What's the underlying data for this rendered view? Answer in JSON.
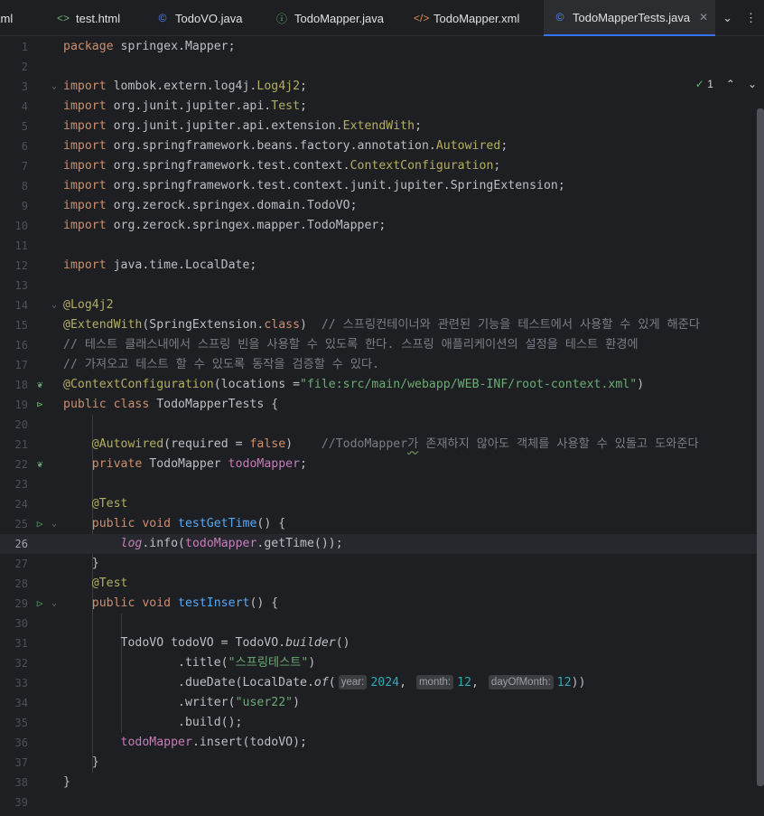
{
  "tabs": [
    {
      "label": "xml",
      "icon": "file-icon",
      "active": false
    },
    {
      "label": "test.html",
      "icon": "html-icon",
      "active": false
    },
    {
      "label": "TodoVO.java",
      "icon": "class-icon",
      "active": false
    },
    {
      "label": "TodoMapper.java",
      "icon": "interface-icon",
      "active": false
    },
    {
      "label": "TodoMapper.xml",
      "icon": "xml-icon",
      "active": false
    },
    {
      "label": "TodoMapperTests.java",
      "icon": "test-class-icon",
      "active": true
    }
  ],
  "tab_close_label": "✕",
  "tab_actions": {
    "chevron": "⌄",
    "more": "⋮"
  },
  "inspections": {
    "count": "1",
    "up": "⌃",
    "down": "⌄"
  },
  "current_line": 26,
  "colors": {
    "background": "#1e1f22",
    "keyword": "#cf8e6d",
    "annotation": "#b3ae60",
    "string": "#6aab73",
    "comment": "#7a7e85",
    "field": "#c77dbb",
    "method": "#56a8f5",
    "number": "#2aacb8",
    "accent": "#3574f0"
  },
  "lines": [
    {
      "n": "1",
      "t": [
        [
          "kw",
          "package "
        ],
        [
          "",
          "springex.Mapper;"
        ]
      ]
    },
    {
      "n": "2",
      "t": []
    },
    {
      "n": "3",
      "t": [
        [
          "kw",
          "import "
        ],
        [
          "",
          "lombok.extern.log4j."
        ],
        [
          "an",
          "Log4j2"
        ],
        [
          "",
          ";"
        ]
      ]
    },
    {
      "n": "4",
      "t": [
        [
          "kw",
          "import "
        ],
        [
          "",
          "org.junit.jupiter.api."
        ],
        [
          "an",
          "Test"
        ],
        [
          "",
          ";"
        ]
      ]
    },
    {
      "n": "5",
      "t": [
        [
          "kw",
          "import "
        ],
        [
          "",
          "org.junit.jupiter.api.extension."
        ],
        [
          "an",
          "ExtendWith"
        ],
        [
          "",
          ";"
        ]
      ]
    },
    {
      "n": "6",
      "t": [
        [
          "kw",
          "import "
        ],
        [
          "",
          "org.springframework.beans.factory.annotation."
        ],
        [
          "an",
          "Autowired"
        ],
        [
          "",
          ";"
        ]
      ]
    },
    {
      "n": "7",
      "t": [
        [
          "kw",
          "import "
        ],
        [
          "",
          "org.springframework.test.context."
        ],
        [
          "an",
          "ContextConfiguration"
        ],
        [
          "",
          ";"
        ]
      ]
    },
    {
      "n": "8",
      "t": [
        [
          "kw",
          "import "
        ],
        [
          "",
          "org.springframework.test.context.junit.jupiter.SpringExtension;"
        ]
      ]
    },
    {
      "n": "9",
      "t": [
        [
          "kw",
          "import "
        ],
        [
          "",
          "org.zerock.springex.domain.TodoVO;"
        ]
      ]
    },
    {
      "n": "10",
      "t": [
        [
          "kw",
          "import "
        ],
        [
          "",
          "org.zerock.springex.mapper.TodoMapper;"
        ]
      ]
    },
    {
      "n": "11",
      "t": []
    },
    {
      "n": "12",
      "t": [
        [
          "kw",
          "import "
        ],
        [
          "",
          "java.time.LocalDate;"
        ]
      ]
    },
    {
      "n": "13",
      "t": []
    },
    {
      "n": "14",
      "t": [
        [
          "an",
          "@Log4j2"
        ]
      ]
    },
    {
      "n": "15",
      "t": [
        [
          "an",
          "@ExtendWith"
        ],
        [
          "",
          "(SpringExtension."
        ],
        [
          "kw",
          "class"
        ],
        [
          "",
          ")  "
        ],
        [
          "cm",
          "// 스프링컨테이너와 관련된 기능을 테스트에서 사용할 수 있게 해준다"
        ]
      ]
    },
    {
      "n": "16",
      "t": [
        [
          "cm",
          "// 테스트 클래스내에서 스프링 빈을 사용할 수 있도록 한다. 스프링 애플리케이션의 설정을 테스트 환경에"
        ]
      ]
    },
    {
      "n": "17",
      "t": [
        [
          "cm",
          "// 가져오고 테스트 할 수 있도록 동작을 검증할 수 있다."
        ]
      ]
    },
    {
      "n": "18",
      "t": [
        [
          "an",
          "@ContextConfiguration"
        ],
        [
          "",
          "(locations ="
        ],
        [
          "str",
          "\"file:src/main/webapp/WEB-INF/root-context.xml\""
        ],
        [
          "",
          ")"
        ]
      ]
    },
    {
      "n": "19",
      "t": [
        [
          "kw",
          "public class "
        ],
        [
          "",
          "TodoMapperTests {"
        ]
      ]
    },
    {
      "n": "20",
      "t": []
    },
    {
      "n": "21",
      "t": [
        [
          "",
          "    "
        ],
        [
          "an",
          "@Autowired"
        ],
        [
          "",
          "(required = "
        ],
        [
          "kw",
          "false"
        ],
        [
          "",
          ")    "
        ],
        [
          "cm",
          "//TodoMapper"
        ],
        [
          "cm sq",
          "가"
        ],
        [
          "cm",
          " 존재하지 않아도 객체를 사용할 수 있돌고 도와준다"
        ]
      ]
    },
    {
      "n": "22",
      "t": [
        [
          "",
          "    "
        ],
        [
          "kw",
          "private "
        ],
        [
          "",
          "TodoMapper "
        ],
        [
          "fld",
          "todoMapper"
        ],
        [
          "",
          ";"
        ]
      ]
    },
    {
      "n": "23",
      "t": []
    },
    {
      "n": "24",
      "t": [
        [
          "",
          "    "
        ],
        [
          "an",
          "@Test"
        ]
      ]
    },
    {
      "n": "25",
      "t": [
        [
          "",
          "    "
        ],
        [
          "kw",
          "public void "
        ],
        [
          "fn",
          "testGetTime"
        ],
        [
          "",
          "() {"
        ]
      ]
    },
    {
      "n": "26",
      "t": [
        [
          "",
          "        "
        ],
        [
          "fld it",
          "log"
        ],
        [
          "",
          ".info("
        ],
        [
          "fld",
          "todoMapper"
        ],
        [
          "",
          ".getTime());"
        ]
      ]
    },
    {
      "n": "27",
      "t": [
        [
          "",
          "    }"
        ]
      ]
    },
    {
      "n": "28",
      "t": [
        [
          "",
          "    "
        ],
        [
          "an",
          "@Test"
        ]
      ]
    },
    {
      "n": "29",
      "t": [
        [
          "",
          "    "
        ],
        [
          "kw",
          "public void "
        ],
        [
          "fn",
          "testInsert"
        ],
        [
          "",
          "() {"
        ]
      ]
    },
    {
      "n": "30",
      "t": []
    },
    {
      "n": "31",
      "t": [
        [
          "",
          "        TodoVO todoVO = TodoVO."
        ],
        [
          "it",
          "builder"
        ],
        [
          "",
          "()"
        ]
      ]
    },
    {
      "n": "32",
      "t": [
        [
          "",
          "                .title("
        ],
        [
          "str",
          "\"스프링테스트\""
        ],
        [
          "",
          ")"
        ]
      ]
    },
    {
      "n": "33",
      "t": [
        [
          "",
          "                .dueDate(LocalDate."
        ],
        [
          "it",
          "of"
        ],
        [
          "",
          "("
        ],
        [
          "hint",
          "year:"
        ],
        [
          "num",
          "2024"
        ],
        [
          "",
          ", "
        ],
        [
          "hint",
          "month:"
        ],
        [
          "num",
          "12"
        ],
        [
          "",
          ", "
        ],
        [
          "hint",
          "dayOfMonth:"
        ],
        [
          "num",
          "12"
        ],
        [
          "",
          "))"
        ]
      ]
    },
    {
      "n": "34",
      "t": [
        [
          "",
          "                .writer("
        ],
        [
          "str",
          "\"user22\""
        ],
        [
          "",
          ")"
        ]
      ]
    },
    {
      "n": "35",
      "t": [
        [
          "",
          "                .build();"
        ]
      ]
    },
    {
      "n": "36",
      "t": [
        [
          "",
          "        "
        ],
        [
          "fld",
          "todoMapper"
        ],
        [
          "",
          ".insert(todoVO);"
        ]
      ]
    },
    {
      "n": "37",
      "t": [
        [
          "",
          "    }"
        ]
      ]
    },
    {
      "n": "38",
      "t": [
        [
          "",
          "}"
        ]
      ]
    },
    {
      "n": "39",
      "t": []
    }
  ],
  "gutter": {
    "18": {
      "icon": "spring-leaf-icon",
      "glyph": "❦",
      "color": "#6aab73"
    },
    "19": {
      "icon": "run-all-icon",
      "glyph": "⊳",
      "color": "#5fb865"
    },
    "22": {
      "icon": "spring-bean-icon",
      "glyph": "❦",
      "color": "#6aab73"
    },
    "25": {
      "icon": "run-test-icon",
      "glyph": "▷",
      "color": "#5fb865"
    },
    "29": {
      "icon": "run-test-icon",
      "glyph": "▷",
      "color": "#5fb865"
    }
  },
  "folds": [
    "3",
    "14",
    "25",
    "29"
  ]
}
